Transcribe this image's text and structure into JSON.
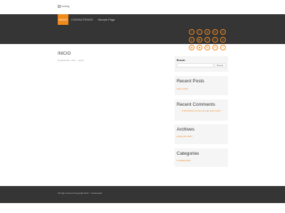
{
  "site": {
    "logo_alt": "tunblog"
  },
  "nav": {
    "items": [
      "INICIO",
      "CONTACTENOS",
      "Sample Page"
    ]
  },
  "social": {
    "icons": [
      "facebook-icon",
      "twitter-icon",
      "google-plus-icon",
      "linkedin-icon",
      "instagram-icon",
      "pinterest-icon",
      "youtube-icon",
      "vimeo-icon",
      "tumblr-icon",
      "flickr-icon",
      "dribbble-icon",
      "github-icon",
      "rss-icon",
      "mail-icon",
      "skype-icon"
    ],
    "glyphs": [
      "f",
      "t",
      "g",
      "in",
      "◎",
      "p",
      "▶",
      "v",
      "t",
      "●",
      "◉",
      "◆",
      "☰",
      "✉",
      "s"
    ],
    "accent": "#f08a1c"
  },
  "post": {
    "title": "INICIO",
    "date": "8 septiembre, 2017",
    "author": "admin"
  },
  "sidebar": {
    "search": {
      "label": "Buscar",
      "button": "Buscar"
    },
    "recent_posts": {
      "title": "Recent Posts",
      "items": [
        "Hello world!"
      ]
    },
    "recent_comments": {
      "title": "Recent Comments",
      "commenter": "A WordPress Commenter",
      "on_text": "en",
      "post": "Hello world!"
    },
    "archives": {
      "title": "Archives",
      "items": [
        "septiembre 2017"
      ]
    },
    "categories": {
      "title": "Categories",
      "items": [
        "Uncategorized"
      ]
    }
  },
  "footer": {
    "text": "All right reserved Copyright 2017 · Codexcoder"
  },
  "colors": {
    "accent": "#f08a1c",
    "dark": "#353535"
  }
}
